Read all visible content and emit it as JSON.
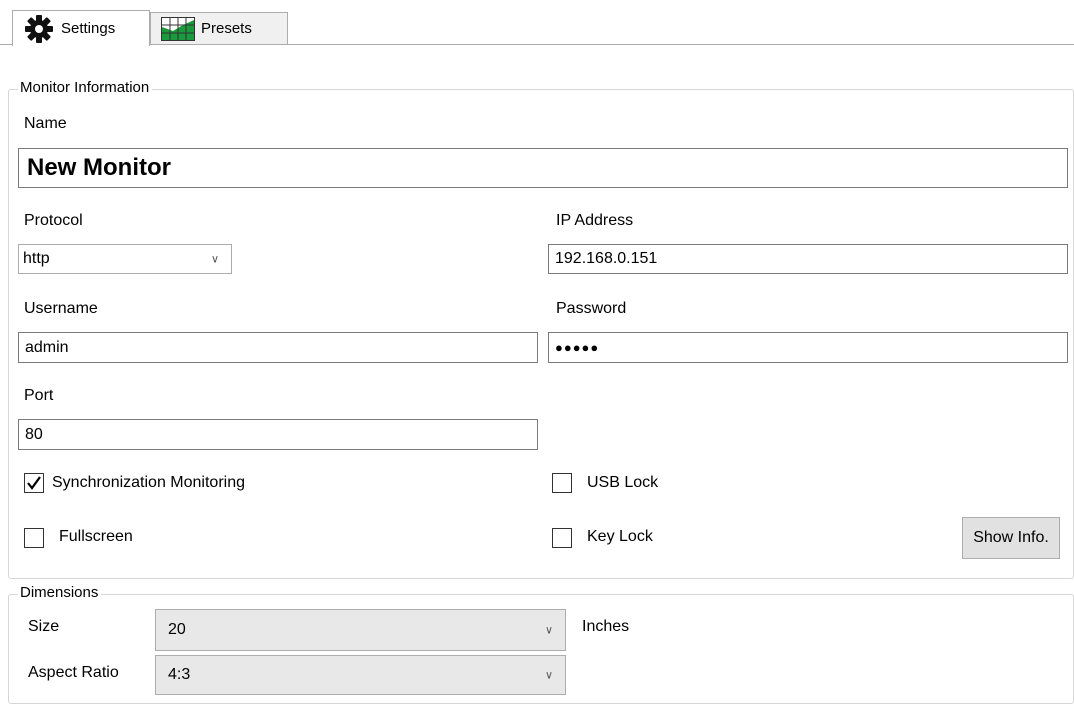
{
  "tabs": [
    {
      "label": "Settings",
      "icon": "gear-icon",
      "active": true
    },
    {
      "label": "Presets",
      "icon": "grid-chart-icon",
      "active": false
    }
  ],
  "monitor_info": {
    "legend": "Monitor Information",
    "name_label": "Name",
    "name_value": "New Monitor",
    "protocol_label": "Protocol",
    "protocol_value": "http",
    "ip_label": "IP Address",
    "ip_value": "192.168.0.151",
    "username_label": "Username",
    "username_value": "admin",
    "password_label": "Password",
    "password_value": "●●●●●",
    "port_label": "Port",
    "port_value": "80",
    "sync_label": "Synchronization Monitoring",
    "sync_checked": true,
    "usb_label": "USB Lock",
    "usb_checked": false,
    "fullscreen_label": "Fullscreen",
    "fullscreen_checked": false,
    "keylock_label": "Key Lock",
    "keylock_checked": false,
    "show_info_label": "Show Info."
  },
  "dimensions": {
    "legend": "Dimensions",
    "size_label": "Size",
    "size_value": "20",
    "size_unit": "Inches",
    "aspect_label": "Aspect Ratio",
    "aspect_value": "4:3"
  },
  "colors": {
    "presets_icon_green": "#1a9a3c",
    "border": "#adadad"
  }
}
